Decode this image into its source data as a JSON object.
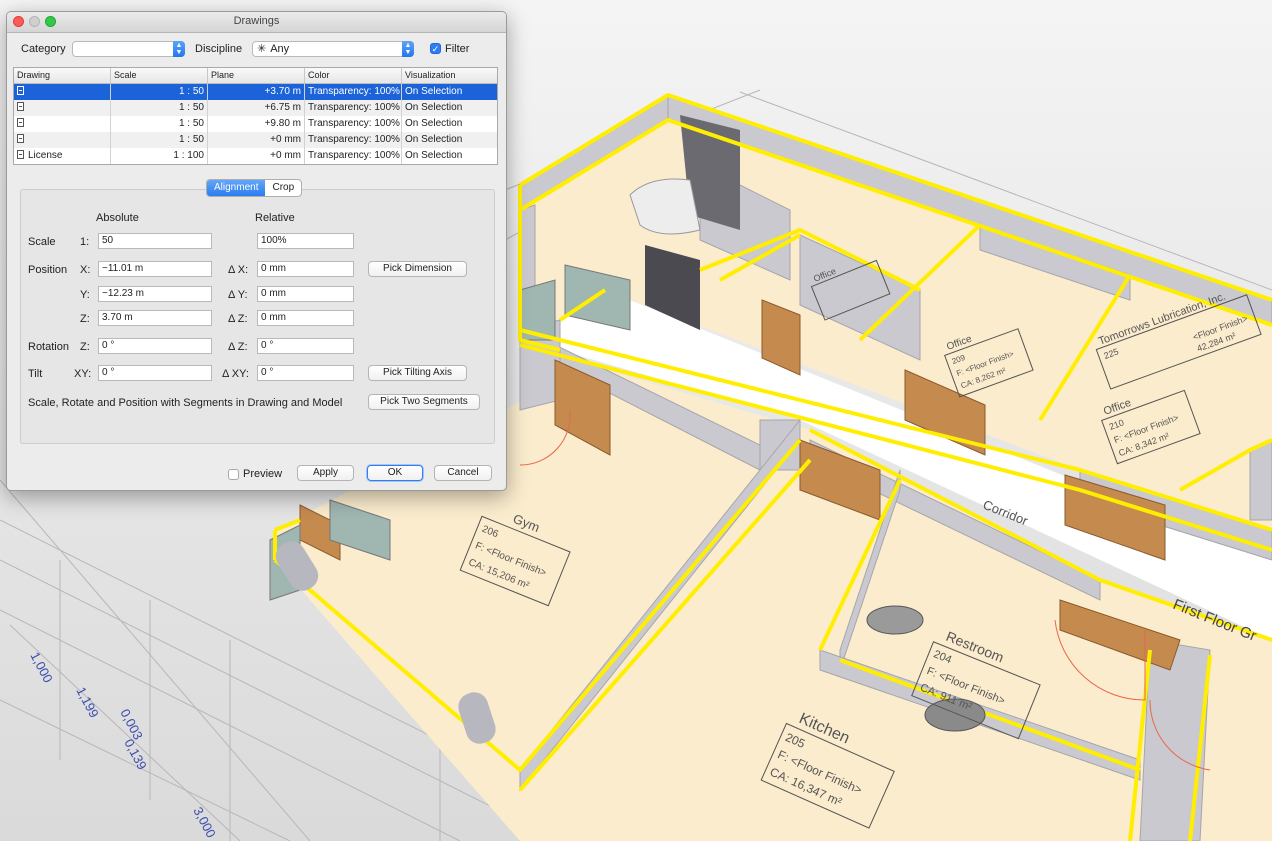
{
  "window": {
    "title": "Drawings"
  },
  "filters": {
    "category_label": "Category",
    "category_value": "",
    "discipline_label": "Discipline",
    "discipline_value": "Any",
    "filter_label": "Filter",
    "filter_checked": true
  },
  "table": {
    "columns": [
      "Drawing",
      "Scale",
      "Plane",
      "Color",
      "Visualization"
    ],
    "rows": [
      {
        "drawing": "",
        "scale": "1 : 50",
        "plane": "+3.70 m",
        "color": "Transparency: 100%",
        "visualization": "On Selection",
        "selected": true
      },
      {
        "drawing": "",
        "scale": "1 : 50",
        "plane": "+6.75 m",
        "color": "Transparency: 100%",
        "visualization": "On Selection",
        "selected": false
      },
      {
        "drawing": "",
        "scale": "1 : 50",
        "plane": "+9.80 m",
        "color": "Transparency: 100%",
        "visualization": "On Selection",
        "selected": false
      },
      {
        "drawing": "",
        "scale": "1 : 50",
        "plane": "+0 mm",
        "color": "Transparency: 100%",
        "visualization": "On Selection",
        "selected": false
      },
      {
        "drawing": "License",
        "scale": "1 : 100",
        "plane": "+0 mm",
        "color": "Transparency: 100%",
        "visualization": "On Selection",
        "selected": false
      }
    ]
  },
  "tabs": {
    "alignment": "Alignment",
    "crop": "Crop",
    "active": "alignment"
  },
  "alignment": {
    "absolute_header": "Absolute",
    "relative_header": "Relative",
    "scale": {
      "label": "Scale",
      "prefix": "1:",
      "absolute": "50",
      "relative": "100%"
    },
    "position": {
      "label": "Position",
      "x_label": "X:",
      "x_value": "−11.01 m",
      "dx_label": "Δ X:",
      "dx_value": "0 mm",
      "y_label": "Y:",
      "y_value": "−12.23 m",
      "dy_label": "Δ Y:",
      "dy_value": "0 mm",
      "z_label": "Z:",
      "z_value": "3.70 m",
      "dz_label": "Δ Z:",
      "dz_value": "0 mm",
      "pick_button": "Pick Dimension"
    },
    "rotation": {
      "label": "Rotation",
      "z_label": "Z:",
      "z_value": "0 °",
      "dz_label": "Δ Z:",
      "dz_value": "0 °"
    },
    "tilt": {
      "label": "Tilt",
      "xy_label": "XY:",
      "xy_value": "0 °",
      "dxy_label": "Δ XY:",
      "dxy_value": "0 °",
      "pick_button": "Pick Tilting Axis"
    },
    "segments": {
      "label": "Scale, Rotate and Position with Segments in Drawing and Model",
      "pick_button": "Pick Two Segments"
    }
  },
  "footer": {
    "preview_label": "Preview",
    "preview_checked": false,
    "apply": "Apply",
    "ok": "OK",
    "cancel": "Cancel"
  },
  "model": {
    "rooms": [
      {
        "name": "Gym",
        "number": "206",
        "finish": "F: <Floor Finish>",
        "area": "CA: 15,206 m²"
      },
      {
        "name": "Restroom",
        "number": "204",
        "finish": "F: <Floor Finish>",
        "area": "CA: 911 m²"
      },
      {
        "name": "Kitchen",
        "number": "205",
        "finish": "F: <Floor Finish>",
        "area": "CA: 16,347 m²"
      },
      {
        "name": "Office",
        "number": "210",
        "finish": "F: <Floor Finish>",
        "area": "CA: 8,342 m²"
      },
      {
        "name": "Office",
        "number": "209",
        "finish": "F: <Floor Finish>",
        "area": "CA: 8,262 m²"
      },
      {
        "name": "Office",
        "number": ""
      },
      {
        "name": "Tomorrows Lubrication, Inc.",
        "number": "225",
        "finish": "<Floor Finish>",
        "area": "42,284 m²"
      }
    ],
    "corridor_label": "Corridor",
    "first_floor_label": "First Floor Gr",
    "dimensions": [
      "1,000",
      "1,199",
      "0,003",
      "0,139",
      "3,000"
    ]
  },
  "colors": {
    "highlight": "#ffee00",
    "floor": "#fbeccd",
    "wall": "#c9c9cf",
    "door": "#c58a4e",
    "selection": "#1c63d9"
  }
}
